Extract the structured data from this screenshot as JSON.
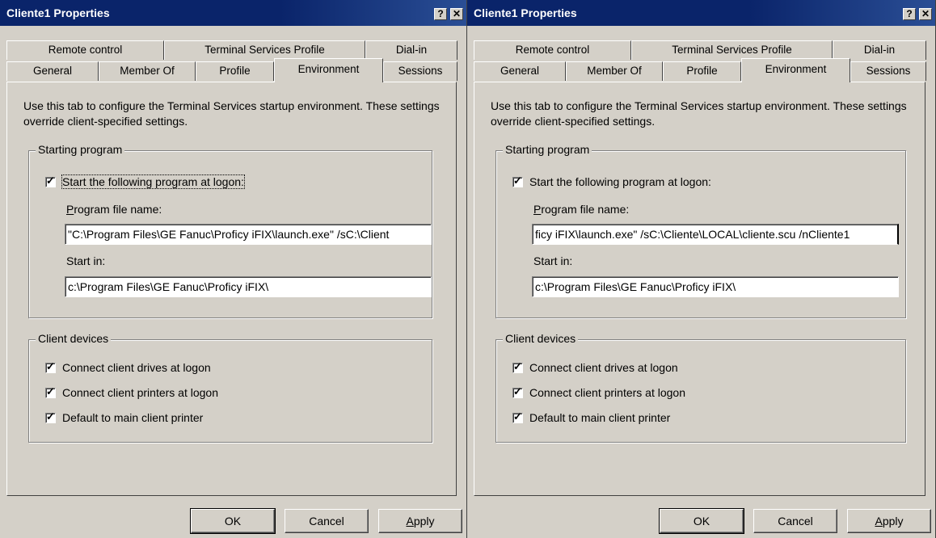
{
  "windows": [
    {
      "title": "Cliente1 Properties",
      "help_button": "?",
      "close_button": "✕",
      "tabs_back": [
        "Remote control",
        "Terminal Services Profile",
        "Dial-in"
      ],
      "tabs_front": [
        "General",
        "Member Of",
        "Profile",
        "Environment",
        "Sessions"
      ],
      "active_tab": "Environment",
      "description": "Use this tab to configure the Terminal Services startup environment. These settings override client-specified settings.",
      "starting_program": {
        "group_label": "Starting program",
        "start_program_label": "Start the following program at logon:",
        "start_program_checked": true,
        "program_file_label": "Program file name:",
        "program_file_value": "\"C:\\Program Files\\GE Fanuc\\Proficy iFIX\\launch.exe\" /sC:\\Client",
        "start_in_label": "Start in:",
        "start_in_value": "c:\\Program Files\\GE Fanuc\\Proficy iFIX\\"
      },
      "client_devices": {
        "group_label": "Client devices",
        "items": [
          {
            "label": "Connect client drives at logon",
            "checked": true
          },
          {
            "label": "Connect client printers at logon",
            "checked": true
          },
          {
            "label": "Default to main client printer",
            "checked": true
          }
        ]
      },
      "buttons": {
        "ok": "OK",
        "cancel": "Cancel",
        "apply": "Apply"
      }
    },
    {
      "title": "Cliente1 Properties",
      "help_button": "?",
      "close_button": "✕",
      "tabs_back": [
        "Remote control",
        "Terminal Services Profile",
        "Dial-in"
      ],
      "tabs_front": [
        "General",
        "Member Of",
        "Profile",
        "Environment",
        "Sessions"
      ],
      "active_tab": "Environment",
      "description": "Use this tab to configure the Terminal Services startup environment. These settings override client-specified settings.",
      "starting_program": {
        "group_label": "Starting program",
        "start_program_label": "Start the following program at logon:",
        "start_program_checked": true,
        "program_file_label": "Program file name:",
        "program_file_value": "ficy iFIX\\launch.exe\" /sC:\\Cliente\\LOCAL\\cliente.scu /nCliente1",
        "start_in_label": "Start in:",
        "start_in_value": "c:\\Program Files\\GE Fanuc\\Proficy iFIX\\"
      },
      "client_devices": {
        "group_label": "Client devices",
        "items": [
          {
            "label": "Connect client drives at logon",
            "checked": true
          },
          {
            "label": "Connect client printers at logon",
            "checked": true
          },
          {
            "label": "Default to main client printer",
            "checked": true
          }
        ]
      },
      "buttons": {
        "ok": "OK",
        "cancel": "Cancel",
        "apply": "Apply"
      }
    }
  ]
}
